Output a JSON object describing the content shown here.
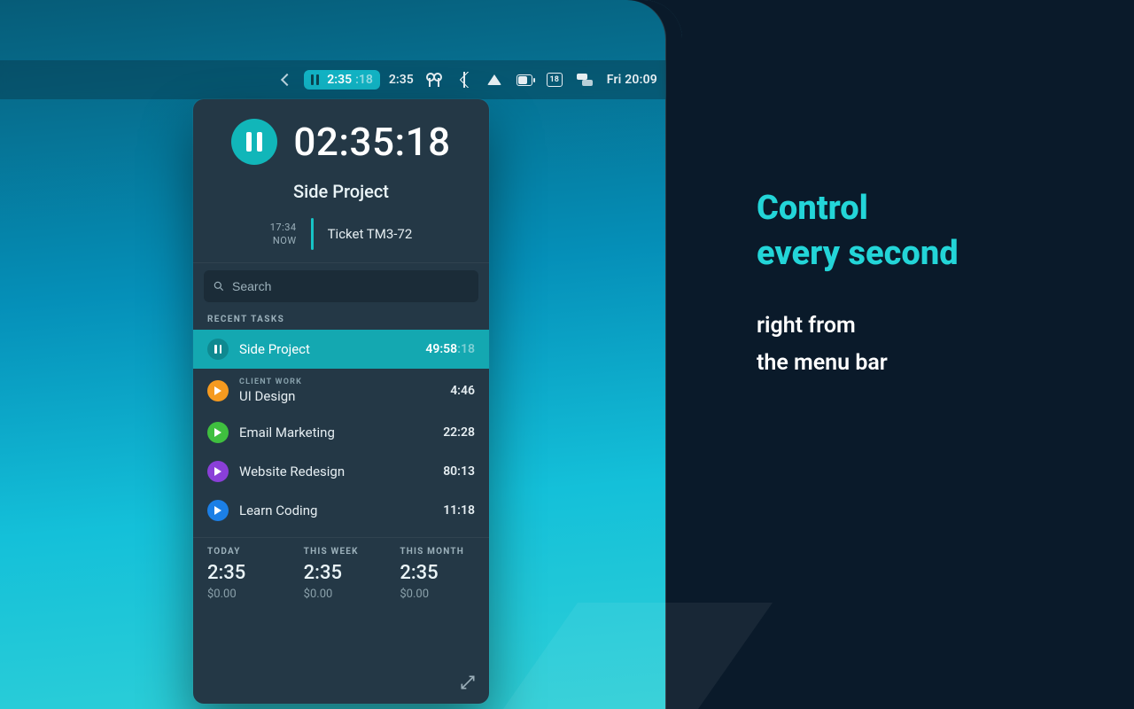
{
  "menubar": {
    "timer_main": "2:35",
    "timer_seconds": ":18",
    "timer_plain": "2:35",
    "calendar_day": "18",
    "clock": "Fri 20:09"
  },
  "popover": {
    "big_time": "02:35:18",
    "project_name": "Side Project",
    "ticket": {
      "start": "17:34",
      "now_label": "NOW",
      "name": "Ticket TM3-72"
    },
    "search_placeholder": "Search",
    "recent_label": "RECENT TASKS",
    "tasks": [
      {
        "name": "Side Project",
        "category": "",
        "time": "49:58",
        "seconds": ":18",
        "active": true,
        "color": "active"
      },
      {
        "name": "UI Design",
        "category": "CLIENT WORK",
        "time": "4:46",
        "seconds": "",
        "active": false,
        "color": "orange"
      },
      {
        "name": "Email Marketing",
        "category": "",
        "time": "22:28",
        "seconds": "",
        "active": false,
        "color": "green"
      },
      {
        "name": "Website Redesign",
        "category": "",
        "time": "80:13",
        "seconds": "",
        "active": false,
        "color": "purple"
      },
      {
        "name": "Learn Coding",
        "category": "",
        "time": "11:18",
        "seconds": "",
        "active": false,
        "color": "blue"
      }
    ],
    "summary": {
      "today": {
        "label": "TODAY",
        "time": "2:35",
        "cost": "$0.00"
      },
      "this_week": {
        "label": "THIS WEEK",
        "time": "2:35",
        "cost": "$0.00"
      },
      "this_month": {
        "label": "THIS MONTH",
        "time": "2:35",
        "cost": "$0.00"
      }
    }
  },
  "promo": {
    "headline_l1": "Control",
    "headline_l2": "every second",
    "sub_l1": "right from",
    "sub_l2": "the menu bar"
  }
}
